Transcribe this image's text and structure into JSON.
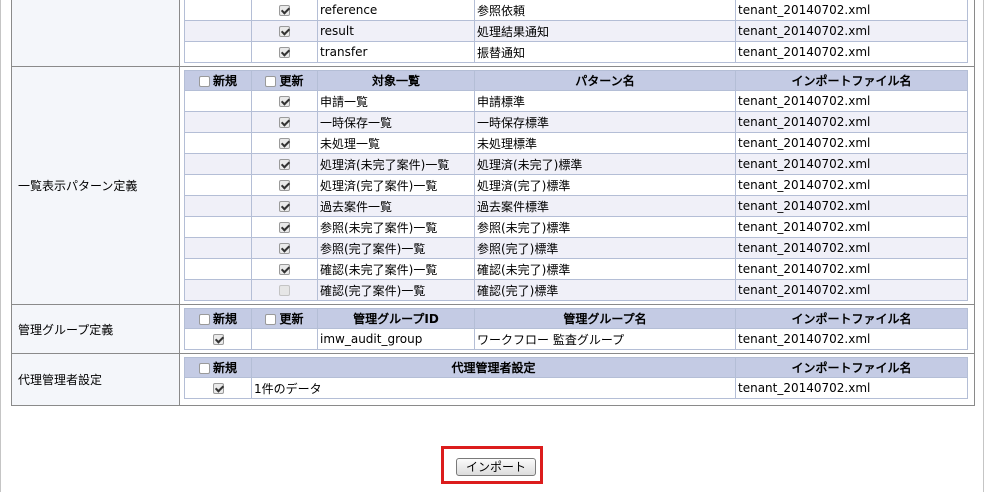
{
  "top_section": {
    "rows": [
      {
        "shinki": false,
        "koushin": true,
        "name": "reference",
        "pattern": "参照依頼",
        "file": "tenant_20140702.xml"
      },
      {
        "shinki": false,
        "koushin": true,
        "name": "result",
        "pattern": "処理結果通知",
        "file": "tenant_20140702.xml"
      },
      {
        "shinki": false,
        "koushin": true,
        "name": "transfer",
        "pattern": "振替通知",
        "file": "tenant_20140702.xml"
      }
    ]
  },
  "list_pattern_section": {
    "label": "一覧表示パターン定義",
    "headers": {
      "shinki": "新規",
      "koushin": "更新",
      "target": "対象一覧",
      "pattern": "パターン名",
      "file": "インポートファイル名"
    },
    "rows": [
      {
        "koushin": true,
        "target": "申請一覧",
        "pattern": "申請標準",
        "file": "tenant_20140702.xml"
      },
      {
        "koushin": true,
        "target": "一時保存一覧",
        "pattern": "一時保存標準",
        "file": "tenant_20140702.xml"
      },
      {
        "koushin": true,
        "target": "未処理一覧",
        "pattern": "未処理標準",
        "file": "tenant_20140702.xml"
      },
      {
        "koushin": true,
        "target": "処理済(未完了案件)一覧",
        "pattern": "処理済(未完了)標準",
        "file": "tenant_20140702.xml"
      },
      {
        "koushin": true,
        "target": "処理済(完了案件)一覧",
        "pattern": "処理済(完了)標準",
        "file": "tenant_20140702.xml"
      },
      {
        "koushin": true,
        "target": "過去案件一覧",
        "pattern": "過去案件標準",
        "file": "tenant_20140702.xml"
      },
      {
        "koushin": true,
        "target": "参照(未完了案件)一覧",
        "pattern": "参照(未完了)標準",
        "file": "tenant_20140702.xml"
      },
      {
        "koushin": true,
        "target": "参照(完了案件)一覧",
        "pattern": "参照(完了)標準",
        "file": "tenant_20140702.xml"
      },
      {
        "koushin": true,
        "target": "確認(未完了案件)一覧",
        "pattern": "確認(未完了)標準",
        "file": "tenant_20140702.xml"
      },
      {
        "koushin": false,
        "target": "確認(完了案件)一覧",
        "pattern": "確認(完了)標準",
        "file": "tenant_20140702.xml"
      }
    ]
  },
  "admin_group_section": {
    "label": "管理グループ定義",
    "headers": {
      "shinki": "新規",
      "koushin": "更新",
      "group_id": "管理グループID",
      "group_name": "管理グループ名",
      "file": "インポートファイル名"
    },
    "rows": [
      {
        "shinki": true,
        "group_id": "imw_audit_group",
        "group_name": "ワークフロー 監査グループ",
        "file": "tenant_20140702.xml"
      }
    ]
  },
  "proxy_admin_section": {
    "label": "代理管理者設定",
    "headers": {
      "shinki": "新規",
      "setting": "代理管理者設定",
      "file": "インポートファイル名"
    },
    "rows": [
      {
        "shinki": true,
        "setting": "1件のデータ",
        "file": "tenant_20140702.xml"
      }
    ]
  },
  "import_button": {
    "label": "インポート",
    "highlight_color": "#dc1c1c"
  }
}
